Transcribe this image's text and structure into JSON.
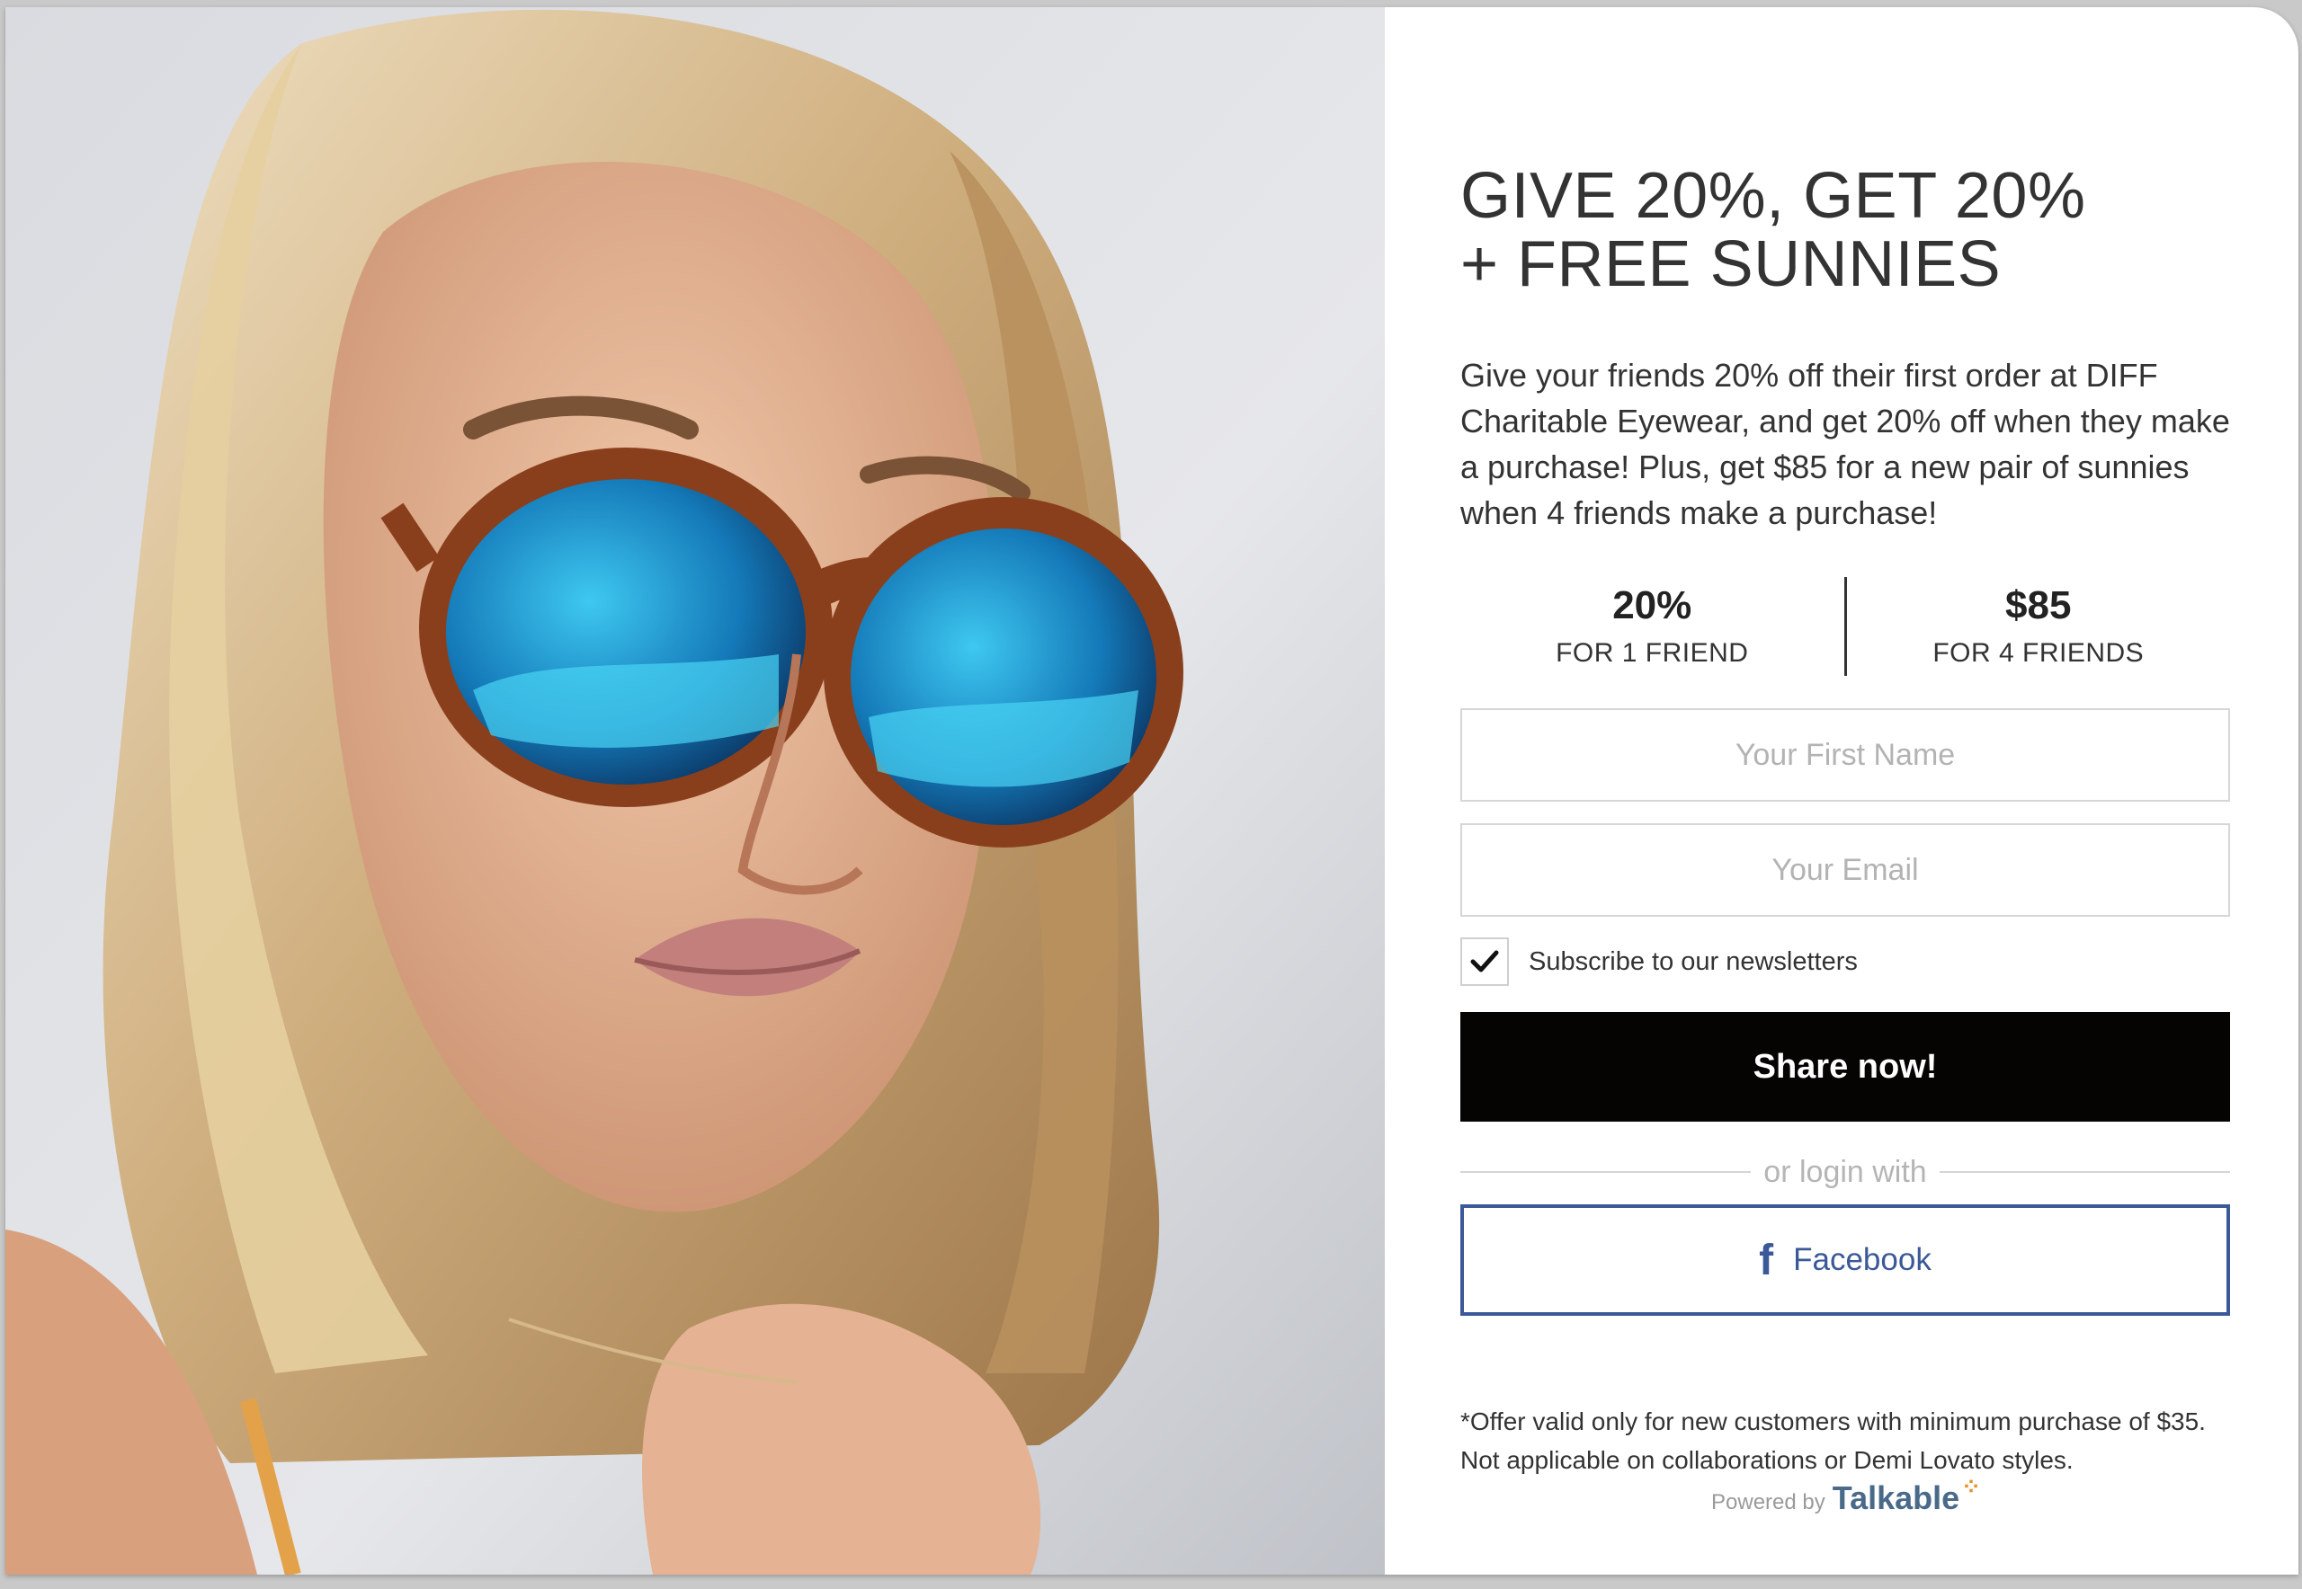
{
  "photo": {
    "alt": "Woman with blonde hair wearing tortoiseshell sunglasses with blue mirrored lenses"
  },
  "headline": {
    "line1": "GIVE 20%, GET 20%",
    "line2": "+ FREE SUNNIES"
  },
  "description": "Give your friends 20% off their first order at DIFF Charitable Eyewear, and get 20% off when they make a purchase! Plus, get $85 for a new pair of sunnies when 4 friends make a purchase!",
  "rewards": [
    {
      "amount": "20%",
      "label": "FOR 1 FRIEND"
    },
    {
      "amount": "$85",
      "label": "FOR 4 FRIENDS"
    }
  ],
  "form": {
    "first_name_placeholder": "Your First Name",
    "email_placeholder": "Your Email",
    "subscribe_label": "Subscribe to our newsletters",
    "subscribe_checked": true,
    "share_button": "Share now!",
    "or_login_text": "or login with",
    "facebook_button": "Facebook",
    "facebook_icon": "f"
  },
  "disclaimer": "*Offer valid only for new customers with minimum purchase of $35. Not applicable on collaborations or Demi Lovato styles.",
  "footer": {
    "powered_by": "Powered by",
    "brand": "Talkable"
  },
  "colors": {
    "share_button_bg": "#060303",
    "facebook_blue": "#3b5998",
    "text": "#333333",
    "field_border": "#d6d6d6"
  }
}
